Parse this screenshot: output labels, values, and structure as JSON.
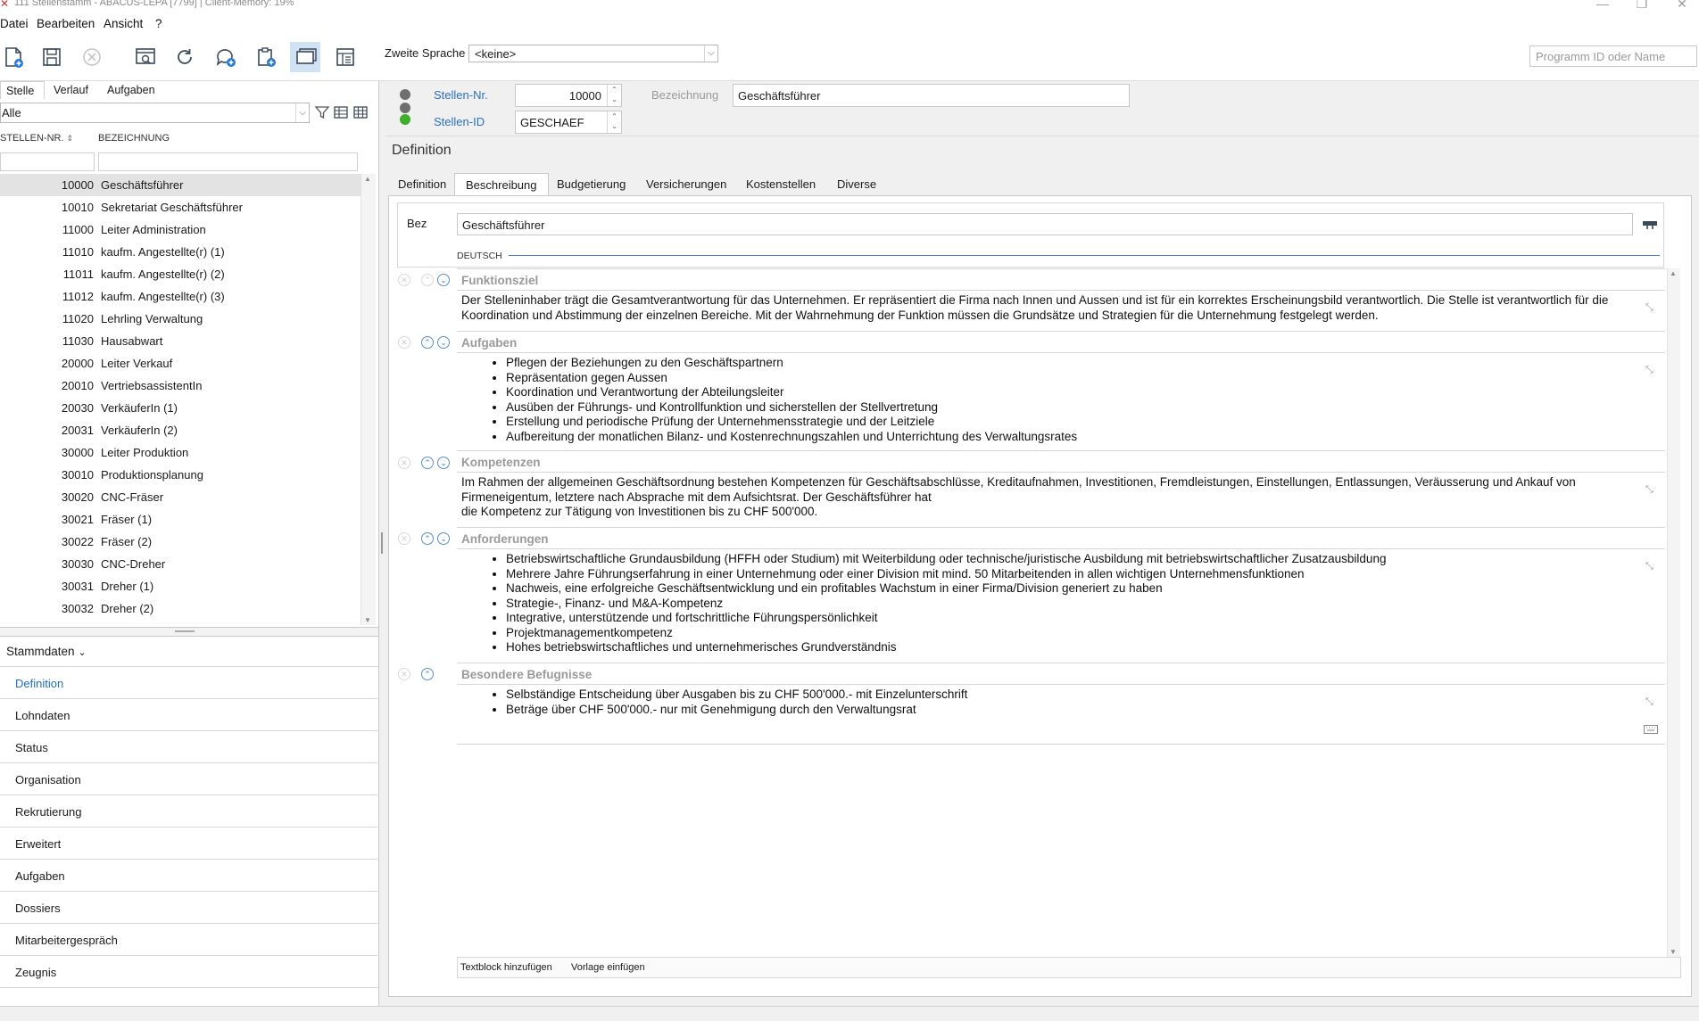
{
  "window": {
    "title": "111 Stellenstamm - ABACUS-LEPA [7799] | Client-Memory: 19%",
    "controls": [
      "—",
      "❐",
      "✕"
    ]
  },
  "menu": [
    {
      "label": "Datei"
    },
    {
      "label": "Bearbeiten"
    },
    {
      "label": "Ansicht"
    },
    {
      "label": "?"
    }
  ],
  "toolbar": {
    "icons": [
      "new-document-icon",
      "save-icon",
      "cancel-icon",
      "preview-icon",
      "refresh-icon",
      "comment-icon",
      "clipboard-icon",
      "window-icon",
      "layout-icon"
    ],
    "zweite_sprache_label": "Zweite Sprache",
    "zweite_sprache_value": "<keine>",
    "program_placeholder": "Programm ID oder Name"
  },
  "left_tabs": [
    "Stelle",
    "Verlauf",
    "Aufgaben"
  ],
  "filter": {
    "value": "Alle"
  },
  "list": {
    "columns": [
      "STELLEN-NR.",
      "BEZEICHNUNG"
    ],
    "rows": [
      {
        "nr": "10000",
        "bez": "Geschäftsführer",
        "selected": true
      },
      {
        "nr": "10010",
        "bez": "Sekretariat Geschäftsführer"
      },
      {
        "nr": "11000",
        "bez": "Leiter Administration"
      },
      {
        "nr": "11010",
        "bez": "kaufm. Angestellte(r) (1)"
      },
      {
        "nr": "11011",
        "bez": "kaufm. Angestellte(r) (2)"
      },
      {
        "nr": "11012",
        "bez": "kaufm. Angestellte(r) (3)"
      },
      {
        "nr": "11020",
        "bez": "Lehrling Verwaltung"
      },
      {
        "nr": "11030",
        "bez": "Hausabwart"
      },
      {
        "nr": "20000",
        "bez": "Leiter Verkauf"
      },
      {
        "nr": "20010",
        "bez": "VertriebsassistentIn"
      },
      {
        "nr": "20030",
        "bez": "VerkäuferIn (1)"
      },
      {
        "nr": "20031",
        "bez": "VerkäuferIn (2)"
      },
      {
        "nr": "30000",
        "bez": "Leiter Produktion"
      },
      {
        "nr": "30010",
        "bez": "Produktionsplanung"
      },
      {
        "nr": "30020",
        "bez": "CNC-Fräser"
      },
      {
        "nr": "30021",
        "bez": "Fräser (1)"
      },
      {
        "nr": "30022",
        "bez": "Fräser (2)"
      },
      {
        "nr": "30030",
        "bez": "CNC-Dreher"
      },
      {
        "nr": "30031",
        "bez": "Dreher (1)"
      },
      {
        "nr": "30032",
        "bez": "Dreher (2)"
      }
    ]
  },
  "nav": {
    "header": "Stammdaten",
    "items": [
      "Definition",
      "Lohndaten",
      "Status",
      "Organisation",
      "Rekrutierung",
      "Erweitert",
      "Aufgaben",
      "Dossiers",
      "Mitarbeitergespräch",
      "Zeugnis"
    ],
    "selected": "Definition"
  },
  "record": {
    "stellen_nr_label": "Stellen-Nr.",
    "stellen_nr_value": "10000",
    "stellen_id_label": "Stellen-ID",
    "stellen_id_value": "GESCHAEF",
    "bezeichnung_label": "Bezeichnung",
    "bezeichnung_value": "Geschäftsführer",
    "status_colors": [
      "#6e6e6e",
      "#6e6e6e",
      "#3fae2a"
    ]
  },
  "section_title": "Definition",
  "tabs": [
    "Definition",
    "Beschreibung",
    "Budgetierung",
    "Versicherungen",
    "Kostenstellen",
    "Diverse"
  ],
  "selected_tab": "Beschreibung",
  "beschreibung": {
    "bez_label": "Bez",
    "bez_value": "Geschäftsführer",
    "language": "DEUTSCH",
    "blocks": {
      "funktionsziel": {
        "title": "Funktionsziel",
        "text": "Der Stelleninhaber trägt die Gesamtverantwortung für das Unternehmen. Er repräsentiert die Firma nach Innen und Aussen und ist für ein korrektes Erscheinungsbild verantwortlich. Die Stelle ist verantwortlich für die Koordination und Abstimmung der einzelnen Bereiche. Mit der Wahrnehmung der Funktion müssen die Grundsätze und Strategien für die Unternehmung festgelegt werden."
      },
      "aufgaben": {
        "title": "Aufgaben",
        "items": [
          "Pflegen der Beziehungen zu den Geschäftspartnern",
          "Repräsentation gegen Aussen",
          "Koordination und Verantwortung der Abteilungsleiter",
          "Ausüben der Führungs- und Kontrollfunktion und sicherstellen der Stellvertretung",
          "Erstellung und periodische Prüfung der Unternehmensstrategie und der Leitziele",
          "Aufbereitung der monatlichen Bilanz- und Kostenrechnungszahlen und Unterrichtung des Verwaltungsrates"
        ]
      },
      "kompetenzen": {
        "title": "Kompetenzen",
        "text_1": "Im Rahmen der allgemeinen Geschäftsordnung bestehen Kompetenzen für Geschäftsabschlüsse, Kreditaufnahmen, Investitionen, Fremdleistungen, Einstellungen, Entlassungen, Veräusserung und Ankauf von Firmeneigentum, letztere nach Absprache mit dem Aufsichtsrat. Der Geschäftsführer hat",
        "text_2": "die Kompetenz zur Tätigung von Investitionen bis zu CHF 500'000."
      },
      "anforderungen": {
        "title": "Anforderungen",
        "items": [
          "Betriebswirtschaftliche Grundausbildung (HFFH oder Studium) mit Weiterbildung oder technische/juristische Ausbildung mit betriebswirtschaftlicher Zusatzausbildung",
          "Mehrere Jahre Führungserfahrung in einer Unternehmung oder einer Division mit mind. 50 Mitarbeitenden in allen wichtigen Unternehmensfunktionen",
          "Nachweis, eine erfolgreiche Geschäftsentwicklung und ein profitables Wachstum in einer Firma/Division generiert zu haben",
          "Strategie-, Finanz- und M&A-Kompetenz",
          "Integrative, unterstützende und fortschrittliche Führungspersönlichkeit",
          "Projektmanagementkompetenz",
          "Hohes betriebswirtschaftliches und unternehmerisches Grundverständnis"
        ]
      },
      "befugnisse": {
        "title": "Besondere Befugnisse",
        "items": [
          "Selbständige Entscheidung über Ausgaben bis zu CHF 500'000.- mit Einzelunterschrift",
          "Beträge über CHF 500'000.- nur mit Genehmigung durch den Verwaltungsrat"
        ]
      }
    },
    "buttons": {
      "add_block": "Textblock hinzufügen",
      "insert_template": "Vorlage einfügen"
    }
  }
}
